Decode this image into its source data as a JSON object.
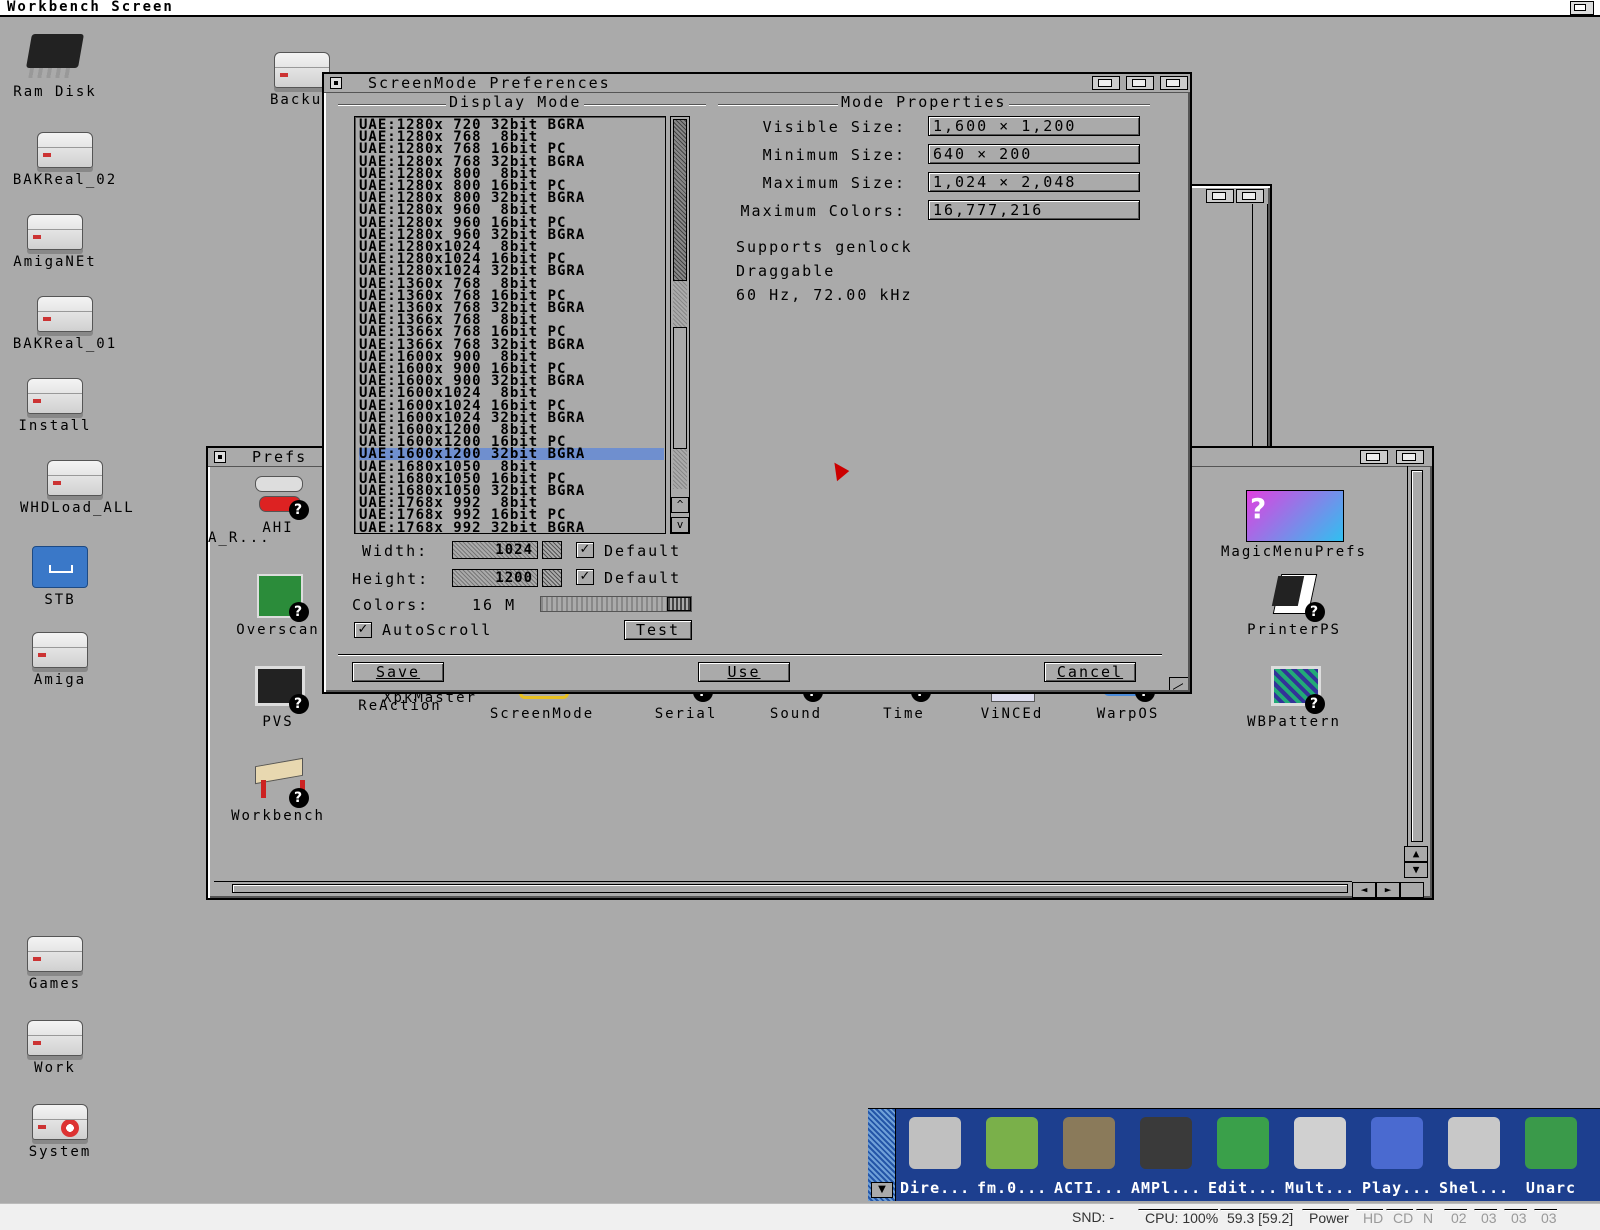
{
  "screen": {
    "title": "Workbench Screen"
  },
  "desktop_icons": [
    {
      "label": "Ram Disk"
    },
    {
      "label": "Backu"
    },
    {
      "label": "BAKReal_02"
    },
    {
      "label": "AmigaNEt"
    },
    {
      "label": "BAKReal_01"
    },
    {
      "label": "Install"
    },
    {
      "label": "WHDLoad_ALL"
    },
    {
      "label": "STB"
    },
    {
      "label": "Amiga"
    },
    {
      "label": "Games"
    },
    {
      "label": "Work"
    },
    {
      "label": "System"
    }
  ],
  "prefs_window": {
    "title": "Prefs",
    "icons": [
      {
        "label": "AHI"
      },
      {
        "label": "Overscan"
      },
      {
        "label": "PVS"
      },
      {
        "label": "ReAction"
      },
      {
        "label": "XpkMaster"
      },
      {
        "label": "ScreenMode"
      },
      {
        "label": "Serial"
      },
      {
        "label": "Sound"
      },
      {
        "label": "Time"
      },
      {
        "label": "ViNCEd"
      },
      {
        "label": "WarpOS"
      },
      {
        "label": "MagicMenuPrefs"
      },
      {
        "label": "PrinterPS"
      },
      {
        "label": "WBPattern"
      },
      {
        "label": "Workbench"
      },
      {
        "label": "A_R..."
      }
    ]
  },
  "screenmode": {
    "title": "ScreenMode Preferences",
    "display_mode_title": "Display Mode",
    "mode_properties_title": "Mode Properties",
    "modes": [
      "UAE:1280x 720 32bit BGRA",
      "UAE:1280x 768  8bit",
      "UAE:1280x 768 16bit PC",
      "UAE:1280x 768 32bit BGRA",
      "UAE:1280x 800  8bit",
      "UAE:1280x 800 16bit PC",
      "UAE:1280x 800 32bit BGRA",
      "UAE:1280x 960  8bit",
      "UAE:1280x 960 16bit PC",
      "UAE:1280x 960 32bit BGRA",
      "UAE:1280x1024  8bit",
      "UAE:1280x1024 16bit PC",
      "UAE:1280x1024 32bit BGRA",
      "UAE:1360x 768  8bit",
      "UAE:1360x 768 16bit PC",
      "UAE:1360x 768 32bit BGRA",
      "UAE:1366x 768  8bit",
      "UAE:1366x 768 16bit PC",
      "UAE:1366x 768 32bit BGRA",
      "UAE:1600x 900  8bit",
      "UAE:1600x 900 16bit PC",
      "UAE:1600x 900 32bit BGRA",
      "UAE:1600x1024  8bit",
      "UAE:1600x1024 16bit PC",
      "UAE:1600x1024 32bit BGRA",
      "UAE:1600x1200  8bit",
      "UAE:1600x1200 16bit PC",
      "UAE:1600x1200 32bit BGRA",
      "UAE:1680x1050  8bit",
      "UAE:1680x1050 16bit PC",
      "UAE:1680x1050 32bit BGRA",
      "UAE:1768x 992  8bit",
      "UAE:1768x 992 16bit PC",
      "UAE:1768x 992 32bit BGRA"
    ],
    "selected_mode": "UAE:1600x1200 32bit BGRA",
    "properties": [
      {
        "label": "Visible Size:",
        "value": "1,600 × 1,200"
      },
      {
        "label": "Minimum Size:",
        "value": "640 × 200"
      },
      {
        "label": "Maximum Size:",
        "value": "1,024 × 2,048"
      },
      {
        "label": "Maximum Colors:",
        "value": "16,777,216"
      }
    ],
    "info_lines": [
      "Supports genlock",
      "Draggable",
      "60 Hz, 72.00 kHz"
    ],
    "width_label": "Width:",
    "width_value": "1024",
    "height_label": "Height:",
    "height_value": "1200",
    "default_label": "Default",
    "width_default_checked": true,
    "height_default_checked": true,
    "colors_label": "Colors:",
    "colors_value": "16 M",
    "colors_level": 1.0,
    "autoscroll_label": "AutoScroll",
    "autoscroll_checked": true,
    "test_label": "Test",
    "save_label": "Save",
    "use_label": "Use",
    "cancel_label": "Cancel"
  },
  "dock": {
    "items": [
      {
        "label": "Dire...",
        "color": "#c0c0c0"
      },
      {
        "label": "fm.0...",
        "color": "#7ab04a"
      },
      {
        "label": "ACTI...",
        "color": "#8a7a5a"
      },
      {
        "label": "AMPl...",
        "color": "#3a3a3a"
      },
      {
        "label": "Edit...",
        "color": "#3aa04a"
      },
      {
        "label": "Mult...",
        "color": "#d0d0d0"
      },
      {
        "label": "Play...",
        "color": "#4a6ad0"
      },
      {
        "label": "Shel...",
        "color": "#c8c8c8"
      },
      {
        "label": "Unarc",
        "color": "#3a9a4a"
      }
    ]
  },
  "status": {
    "snd": "SND: -",
    "cpu": "CPU: 100%",
    "fps": "59.3 [59.2]",
    "power": "Power",
    "hd": "HD",
    "cd": "CD",
    "n": "N",
    "d1": "02",
    "d2": "03",
    "d3": "03",
    "d4": "03"
  }
}
